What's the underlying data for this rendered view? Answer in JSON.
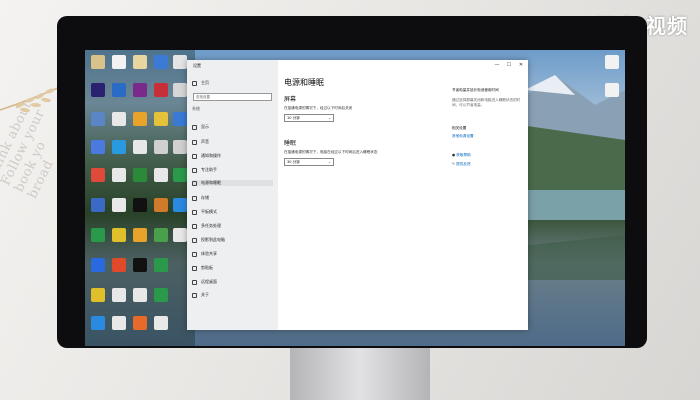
{
  "watermark": "天奇·视频",
  "deco_text": "Think about\nFollow your\nbook yo\nbroad",
  "window": {
    "app_title": "设置",
    "controls": [
      "—",
      "☐",
      "✕"
    ],
    "home_label": "主页",
    "search_placeholder": "查找设置",
    "section_label": "系统",
    "nav_items": [
      "显示",
      "声音",
      "通知和操作",
      "专注助手",
      "电源和睡眠",
      "存储",
      "平板模式",
      "多任务处理",
      "投影到此电脑",
      "体验共享",
      "剪贴板",
      "远程桌面",
      "关于"
    ]
  },
  "content": {
    "title": "电源和睡眠",
    "screen_heading": "屏幕",
    "screen_label": "在接通电源的情况下，经过以下时间后关闭",
    "screen_value": "10 分钟",
    "sleep_heading": "睡眠",
    "sleep_label": "在接通电源的情况下，电脑在经过以下时间后进入睡眠状态",
    "sleep_value": "30 分钟"
  },
  "right_panel": {
    "tip": "节省电量并延长电池使用时间",
    "tip_detail": "通过选择屏幕关闭和电脑进入睡眠状态的时间，可以节省电量。",
    "related_heading": "相关设置",
    "related_link": "其他电源设置",
    "help_link": "获取帮助",
    "feedback_link": "提供反馈"
  },
  "colors": {
    "accent": "#0067c0"
  }
}
